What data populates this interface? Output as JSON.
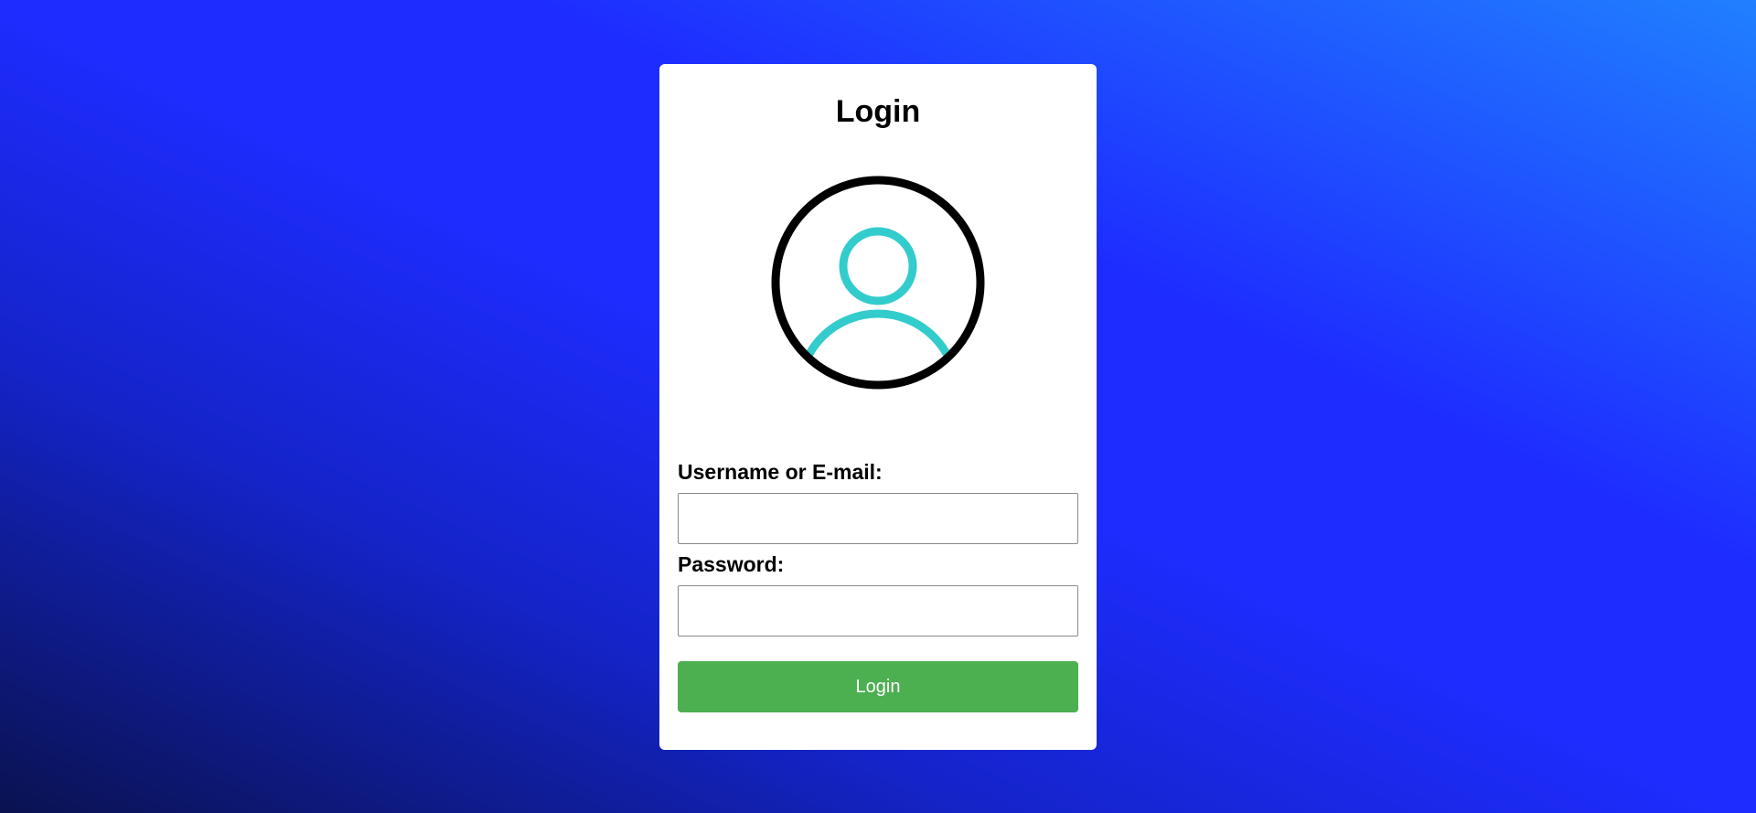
{
  "login_card": {
    "title": "Login",
    "avatar_icon": "user-avatar-icon",
    "username_label": "Username or E-mail:",
    "username_value": "",
    "password_label": "Password:",
    "password_value": "",
    "submit_label": "Login"
  },
  "colors": {
    "background_gradient": [
      "#0a1250",
      "#1e2cff",
      "#2080ff"
    ],
    "card": "#ffffff",
    "avatar_ring": "#000000",
    "avatar_figure": "#33cccc",
    "button": "#4caf50",
    "button_text": "#ffffff"
  }
}
